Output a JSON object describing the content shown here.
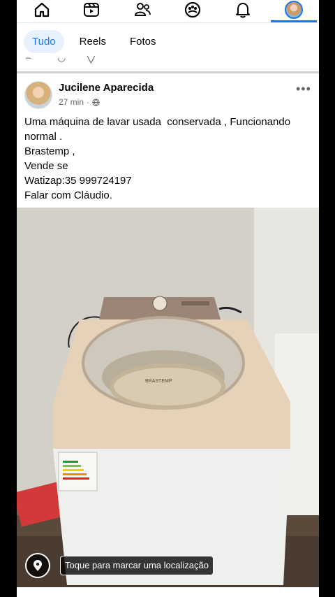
{
  "nav": {
    "items": [
      {
        "name": "home-icon"
      },
      {
        "name": "reels-icon"
      },
      {
        "name": "friends-icon"
      },
      {
        "name": "groups-icon"
      },
      {
        "name": "notifications-icon"
      },
      {
        "name": "profile-avatar"
      }
    ],
    "accent": "#1877f2"
  },
  "filters": {
    "tabs": [
      "Tudo",
      "Reels",
      "Fotos"
    ],
    "active": "Tudo"
  },
  "post": {
    "author": "Jucilene Aparecida",
    "time": "27 min",
    "privacy_icon": "globe-icon",
    "more_label": "•••",
    "text_lines": [
      "Uma máquina de lavar usada  conservada , Funcionando",
      "normal .",
      "Brastemp ,",
      "Vende se",
      "Watizap:35 999724197",
      "Falar com Cláudio."
    ],
    "photo": {
      "brand_on_lid": "BRASTEMP",
      "location_prompt": "Toque para marcar uma localização"
    }
  }
}
